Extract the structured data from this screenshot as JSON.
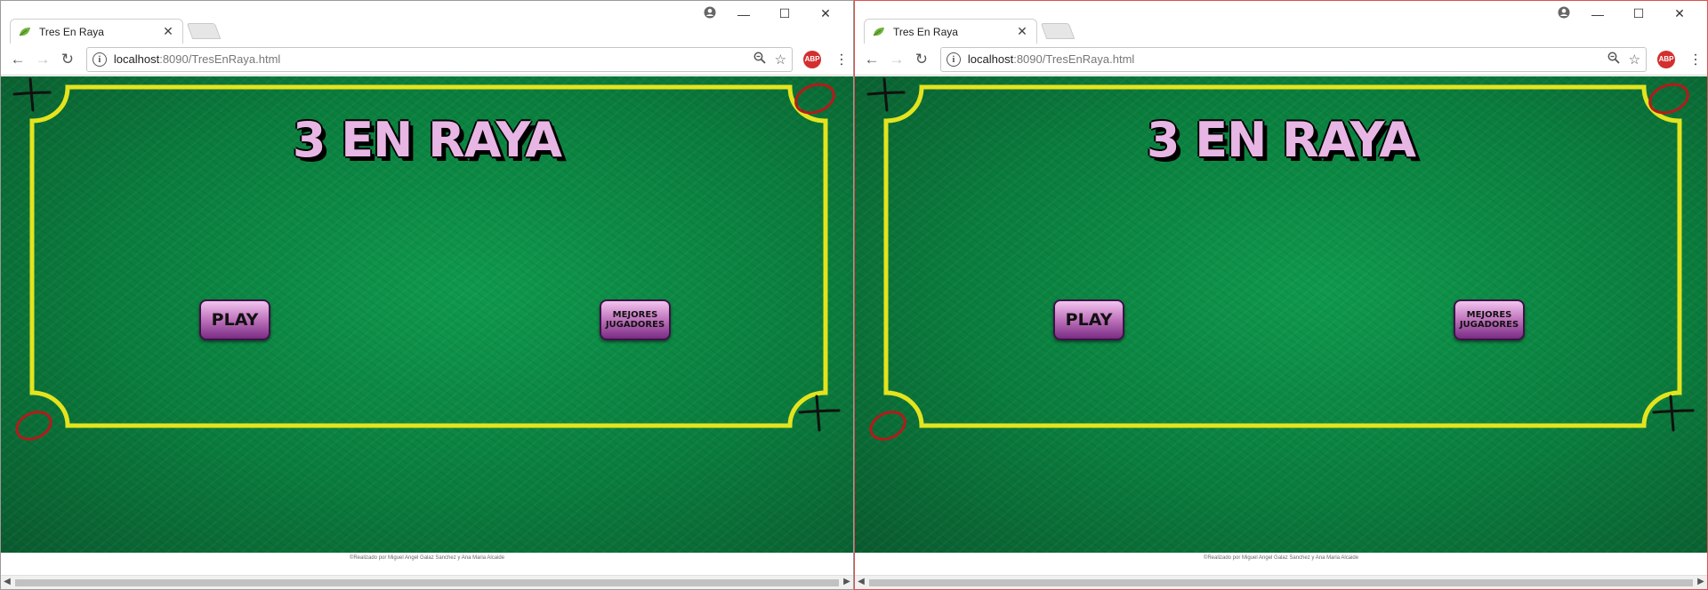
{
  "windows": [
    {
      "tab": {
        "title": "Tres En Raya",
        "close": "✕"
      },
      "address": {
        "host": "localhost",
        "path": ":8090/TresEnRaya.html"
      },
      "controls": {
        "minimize": "—",
        "maximize": "☐",
        "close": "✕"
      },
      "game": {
        "title": "3 EN RAYA",
        "play_label": "PLAY",
        "best_label": "MEJORES JUGADORES"
      },
      "footer": "©Realizado por Miguel Angel Galaz Sanchez y Ana Maria Alcaide"
    },
    {
      "tab": {
        "title": "Tres En Raya",
        "close": "✕"
      },
      "address": {
        "host": "localhost",
        "path": ":8090/TresEnRaya.html"
      },
      "controls": {
        "minimize": "—",
        "maximize": "☐",
        "close": "✕"
      },
      "game": {
        "title": "3 EN RAYA",
        "play_label": "PLAY",
        "best_label": "MEJORES JUGADORES"
      },
      "footer": "©Realizado por Miguel Angel Galaz Sanchez y Ana Maria Alcaide"
    }
  ],
  "toolbar": {
    "abp_label": "ABP"
  },
  "colors": {
    "felt": "#0a7d3d",
    "border": "#e4e41e",
    "x_mark": "#111111",
    "o_mark": "#b51a1a",
    "button": "#c47ac0"
  }
}
